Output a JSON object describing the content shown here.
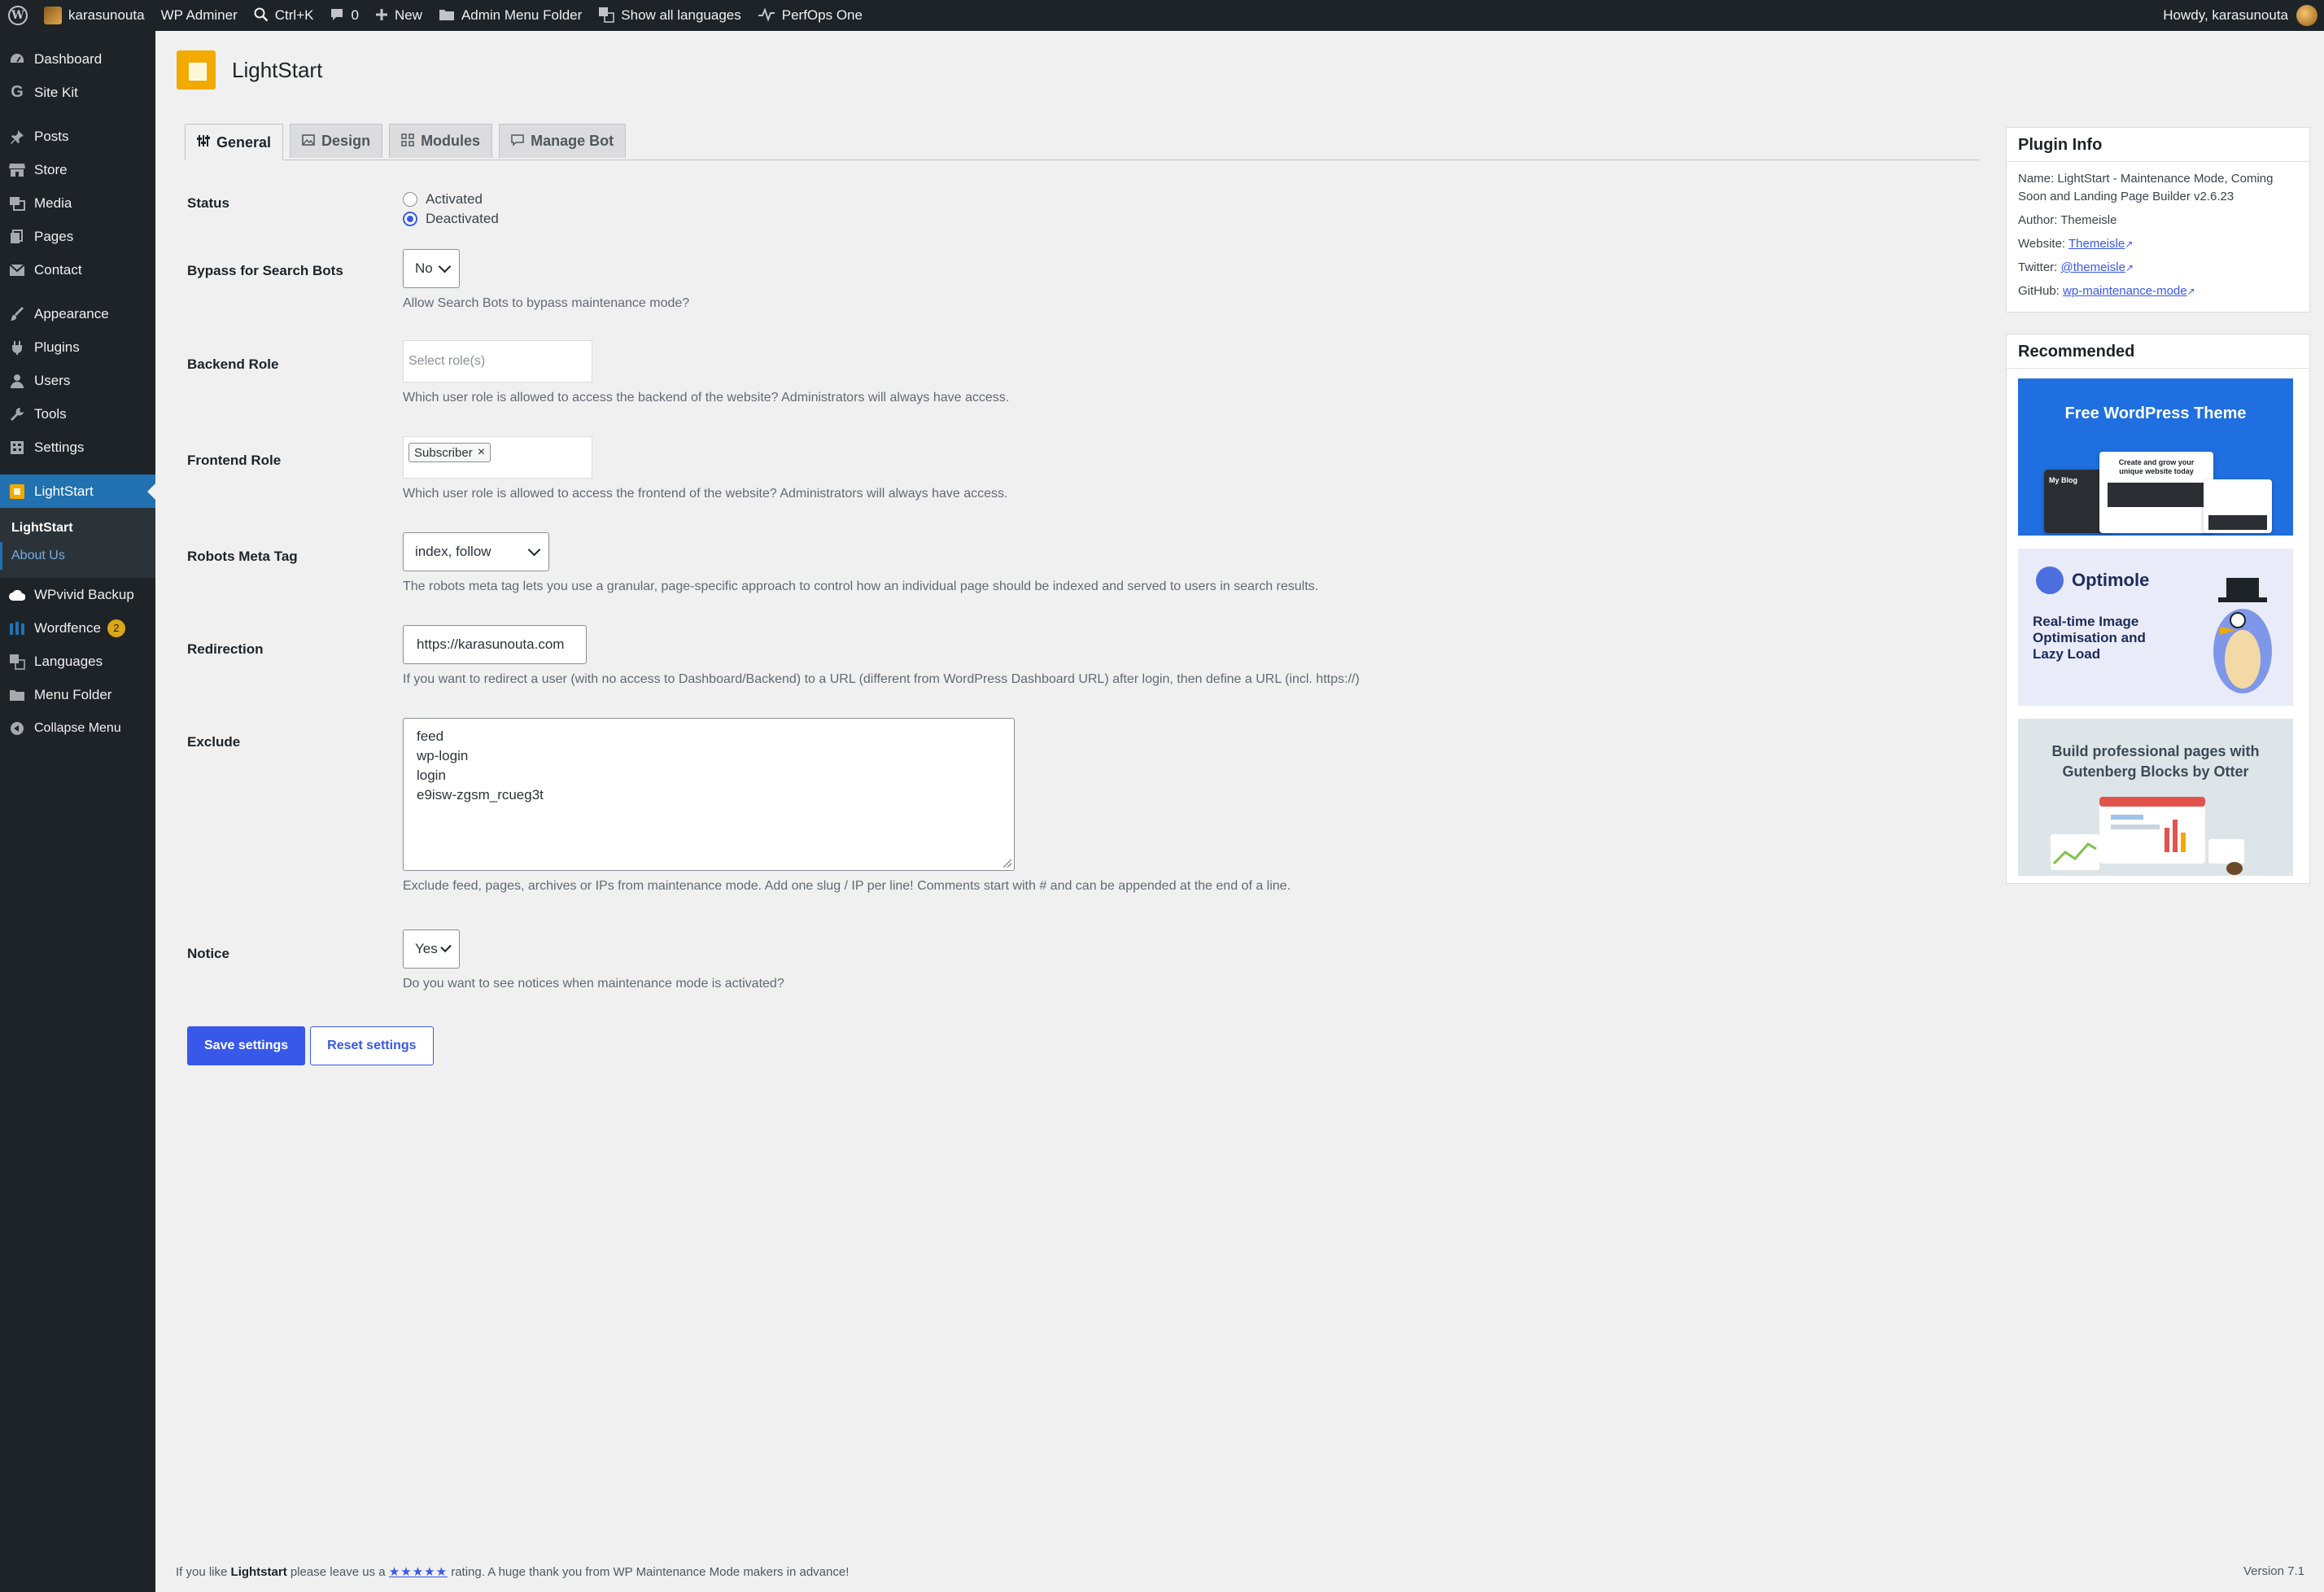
{
  "adminbar": {
    "site": "karasunouta",
    "items": [
      "WP Adminer",
      "Ctrl+K",
      "0",
      "New",
      "Admin Menu Folder",
      "Show all languages",
      "PerfOps One"
    ],
    "greeting": "Howdy, karasunouta"
  },
  "sidebar": {
    "items": [
      "Dashboard",
      "Site Kit",
      "Posts",
      "Store",
      "Media",
      "Pages",
      "Contact",
      "Appearance",
      "Plugins",
      "Users",
      "Tools",
      "Settings",
      "LightStart",
      "WPvivid Backup",
      "Wordfence",
      "Languages",
      "Menu Folder",
      "Collapse Menu"
    ],
    "submenu": [
      "LightStart",
      "About Us"
    ],
    "wordfence_badge": "2"
  },
  "page": {
    "title": "LightStart"
  },
  "tabs": [
    "General",
    "Design",
    "Modules",
    "Manage Bot"
  ],
  "form": {
    "status": {
      "label": "Status",
      "options": [
        "Activated",
        "Deactivated"
      ],
      "selected": "Deactivated"
    },
    "bypass": {
      "label": "Bypass for Search Bots",
      "value": "No",
      "desc": "Allow Search Bots to bypass maintenance mode?"
    },
    "backend_role": {
      "label": "Backend Role",
      "placeholder": "Select role(s)",
      "desc": "Which user role is allowed to access the backend of the website? Administrators will always have access."
    },
    "frontend_role": {
      "label": "Frontend Role",
      "chip": "Subscriber",
      "desc": "Which user role is allowed to access the frontend of the website? Administrators will always have access."
    },
    "robots": {
      "label": "Robots Meta Tag",
      "value": "index, follow",
      "desc": "The robots meta tag lets you use a granular, page-specific approach to control how an individual page should be indexed and served to users in search results."
    },
    "redirection": {
      "label": "Redirection",
      "value": "https://karasunouta.com",
      "desc": "If you want to redirect a user (with no access to Dashboard/Backend) to a URL (different from WordPress Dashboard URL) after login, then define a URL (incl. https://)"
    },
    "exclude": {
      "label": "Exclude",
      "lines": [
        "feed",
        "wp-login",
        "login",
        "e9isw-zgsm_rcueg3t"
      ],
      "desc": "Exclude feed, pages, archives or IPs from maintenance mode. Add one slug / IP per line! Comments start with # and can be appended at the end of a line."
    },
    "notice": {
      "label": "Notice",
      "value": "Yes",
      "desc": "Do you want to see notices when maintenance mode is activated?"
    }
  },
  "buttons": {
    "save": "Save settings",
    "reset": "Reset settings"
  },
  "plugin_info": {
    "title": "Plugin Info",
    "name": "Name: LightStart - Maintenance Mode, Coming Soon and Landing Page Builder v2.6.23",
    "author": "Author: Themeisle",
    "website_label": "Website:",
    "website": "Themeisle",
    "twitter_label": "Twitter:",
    "twitter": "@themeisle",
    "github_label": "GitHub:",
    "github": "wp-maintenance-mode"
  },
  "recommended": {
    "title": "Recommended",
    "promo1": "Free WordPress Theme",
    "promo1_mock_title": "Create and grow your unique website today",
    "promo1_blog": "My Blog",
    "promo2_brand": "Optimole",
    "promo2_tag": "Real-time Image Optimisation and Lazy Load",
    "promo3": "Build professional pages with Gutenberg Blocks by Otter"
  },
  "footer": {
    "pre": "If you like ",
    "brand": "Lightstart",
    "mid": " please leave us a ",
    "stars": "★★★★★",
    "post": " rating. A huge thank you from WP Maintenance Mode makers in advance!",
    "version": "Version 7.1"
  },
  "colors": {
    "accent": "#3858e9",
    "sidebar": "#1d2327",
    "current": "#2271b1",
    "lightstart": "#f2a900"
  }
}
